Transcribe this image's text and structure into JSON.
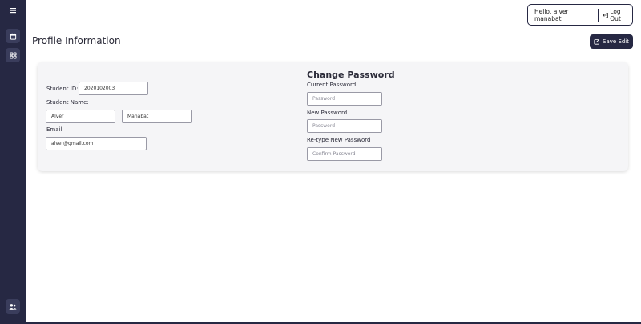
{
  "header": {
    "greeting": "Hello, alver manabat",
    "logout_label": "Log Out"
  },
  "page": {
    "title": "Profile Information",
    "save_label": "Save Edit"
  },
  "profile": {
    "student_id_label": "Student ID:",
    "student_id_value": "2020102003",
    "student_name_label": "Student Name:",
    "first_name_value": "Alver",
    "last_name_value": "Manabat",
    "email_label": "Email",
    "email_value": "alver@gmail.com"
  },
  "password": {
    "title": "Change Password",
    "current_label": "Current Password",
    "current_placeholder": "Password",
    "new_label": "New Password",
    "new_placeholder": "Password",
    "retype_label": "Re-type New Password",
    "retype_placeholder": "Confirm Password"
  },
  "sidebar": {
    "icons": [
      "menu-icon",
      "calendar-icon",
      "grid-icon",
      "users-icon"
    ]
  },
  "colors": {
    "sidebar": "#262843",
    "accent": "#262843",
    "card": "#f5f5f7"
  }
}
